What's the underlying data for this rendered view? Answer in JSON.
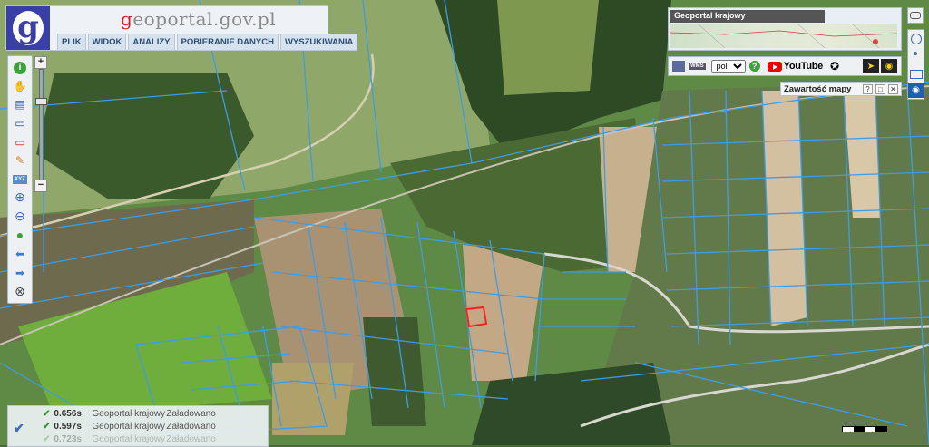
{
  "header": {
    "site_title_g": "g",
    "site_title_rest": "eoportal.gov.pl",
    "logo_letter": "g",
    "menu": [
      "PLIK",
      "WIDOK",
      "ANALIZY",
      "POBIERANIE DANYCH",
      "WYSZUKIWANIA"
    ]
  },
  "toolbar": {
    "tools": [
      {
        "icon": "info-icon",
        "glyph": "i"
      },
      {
        "icon": "pan-hand-icon",
        "glyph": "✋"
      },
      {
        "icon": "legend-icon",
        "glyph": "▤"
      },
      {
        "icon": "select-window-icon",
        "glyph": "▭"
      },
      {
        "icon": "select-red-icon",
        "glyph": "▭"
      },
      {
        "icon": "measure-icon",
        "glyph": "✎"
      },
      {
        "icon": "xyz-icon",
        "glyph": "XYZ"
      },
      {
        "icon": "zoom-in-icon",
        "glyph": "⊕"
      },
      {
        "icon": "zoom-out-icon",
        "glyph": "⊖"
      },
      {
        "icon": "globe-icon",
        "glyph": "●"
      },
      {
        "icon": "back-arrow-icon",
        "glyph": "⬅"
      },
      {
        "icon": "forward-arrow-icon",
        "glyph": "➡"
      },
      {
        "icon": "full-extent-icon",
        "glyph": "⊗"
      }
    ],
    "zoom_plus": "+",
    "zoom_minus": "−"
  },
  "overview": {
    "title": "Geoportal krajowy"
  },
  "services": {
    "wms_label": "WMS",
    "language": "pol",
    "languages": [
      "pol"
    ],
    "youtube_label": "YouTube"
  },
  "contents": {
    "title": "Zawartość mapy",
    "help": "?",
    "window": "□",
    "close": "✕"
  },
  "log": {
    "rows": [
      {
        "time": "0.656s",
        "source": "Geoportal krajowy",
        "status": "Załadowano"
      },
      {
        "time": "0.597s",
        "source": "Geoportal krajowy",
        "status": "Załadowano"
      },
      {
        "time": "0.723s",
        "source": "Geoportal krajowy",
        "status": "Załadowano"
      }
    ]
  },
  "colors": {
    "parcel_line": "#3f9be6",
    "selected_parcel": "#ff2020",
    "logo_bg": "#3a3fa8"
  }
}
